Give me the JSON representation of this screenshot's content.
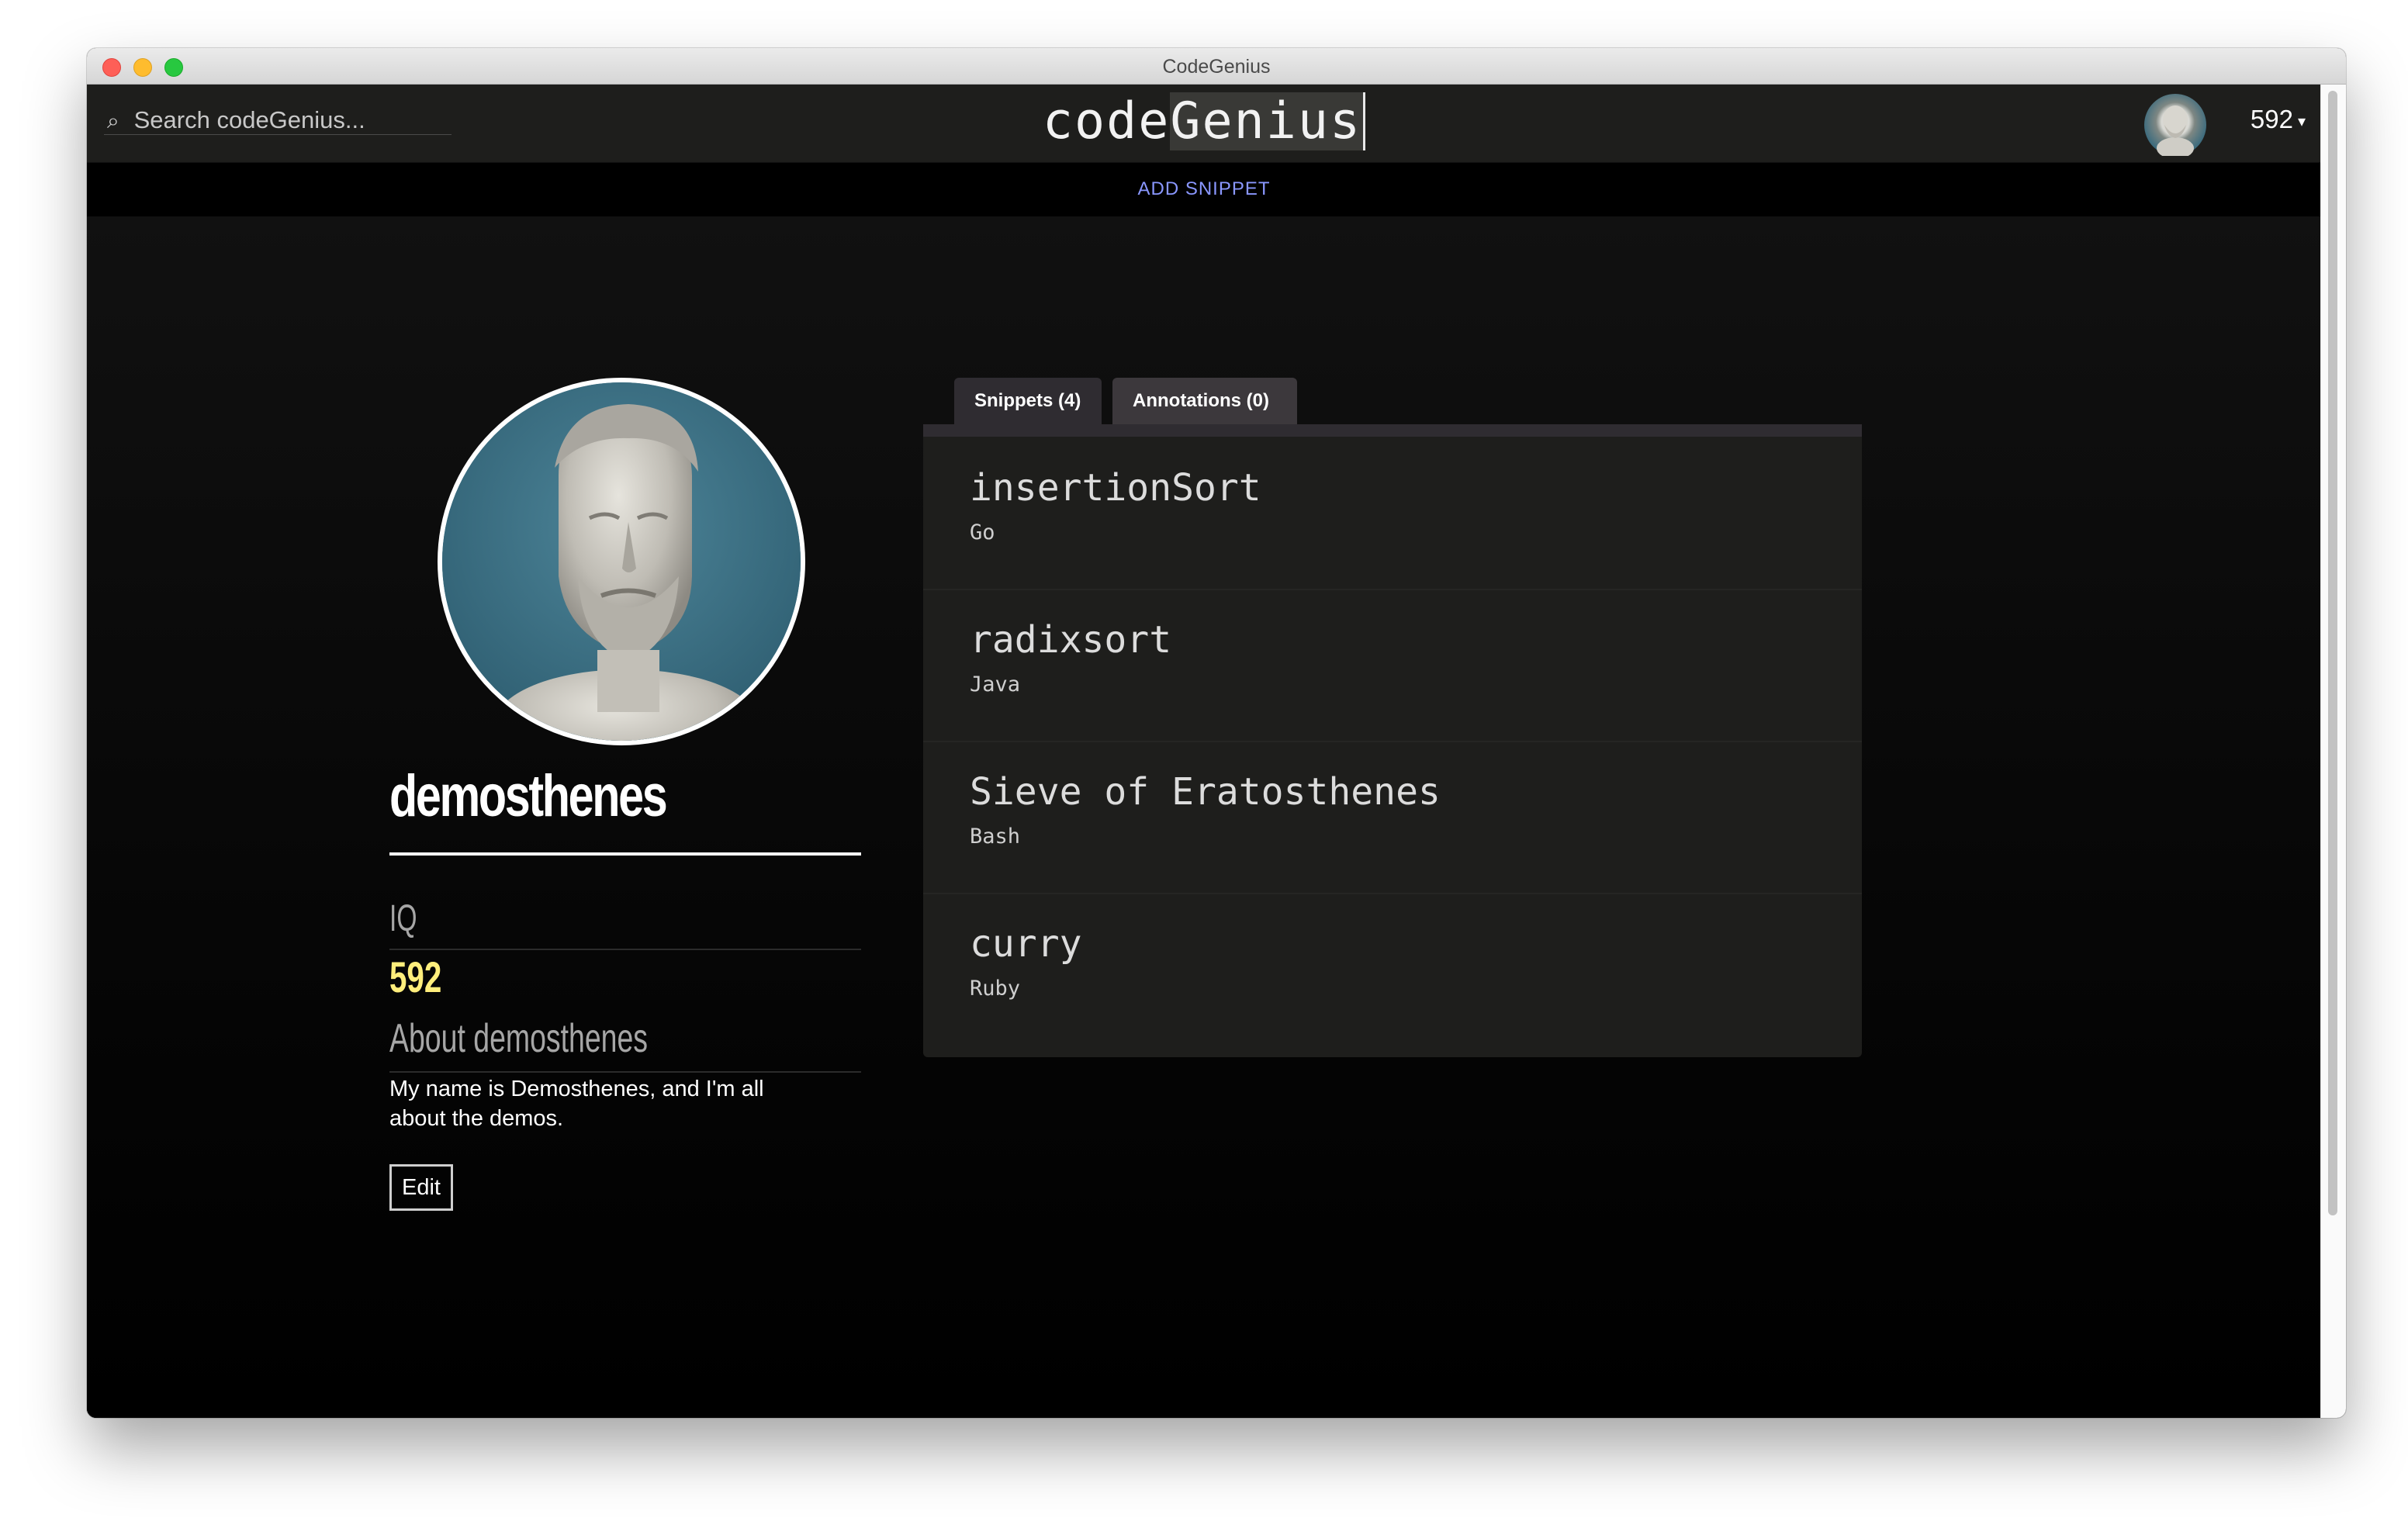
{
  "window": {
    "title": "CodeGenius"
  },
  "header": {
    "search_placeholder": "Search codeGenius...",
    "search_icon": "⌕",
    "brand_prefix": "code",
    "brand_highlight": "Genius",
    "user_iq": "592",
    "caret": "▾"
  },
  "subnav": {
    "add_snippet": "ADD SNIPPET"
  },
  "profile": {
    "username": "demosthenes",
    "iq_label": "IQ",
    "iq_value": "592",
    "about_label": "About demosthenes",
    "about_text": "My name is Demosthenes, and I'm all about the demos.",
    "edit_label": "Edit"
  },
  "tabs": [
    {
      "label": "Snippets (4)",
      "active": true
    },
    {
      "label": "Annotations (0)",
      "active": false
    }
  ],
  "snippets": [
    {
      "title": "insertionSort",
      "language": "Go"
    },
    {
      "title": "radixsort",
      "language": "Java"
    },
    {
      "title": "Sieve of Eratosthenes",
      "language": "Bash"
    },
    {
      "title": "curry",
      "language": "Ruby"
    }
  ],
  "colors": {
    "accent_link": "#8a97ff",
    "iq_highlight": "#ffee7c",
    "panel": "#1e1e1c",
    "tab_active": "#2f2c31"
  }
}
